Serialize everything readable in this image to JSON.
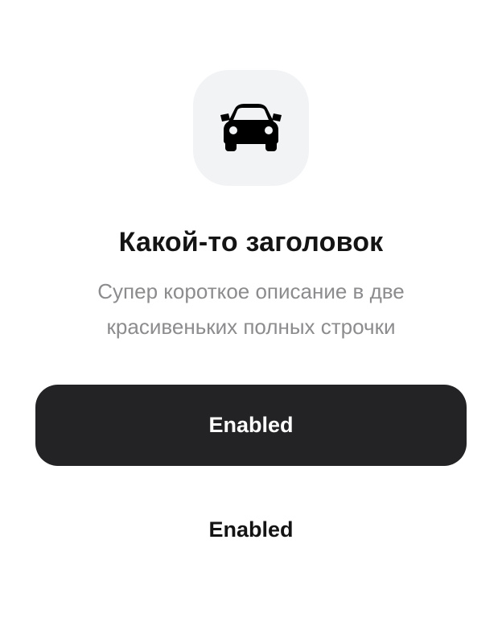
{
  "icon": {
    "name": "car-icon",
    "tile_color": "#f2f3f5",
    "glyph_color": "#000000"
  },
  "title": "Какой-то заголовок",
  "description": "Супер короткое описание в две красивеньких полных строчки",
  "primary_button": {
    "label": "Enabled",
    "background": "#232325",
    "text_color": "#ffffff"
  },
  "secondary_button": {
    "label": "Enabled",
    "text_color": "#141414"
  }
}
